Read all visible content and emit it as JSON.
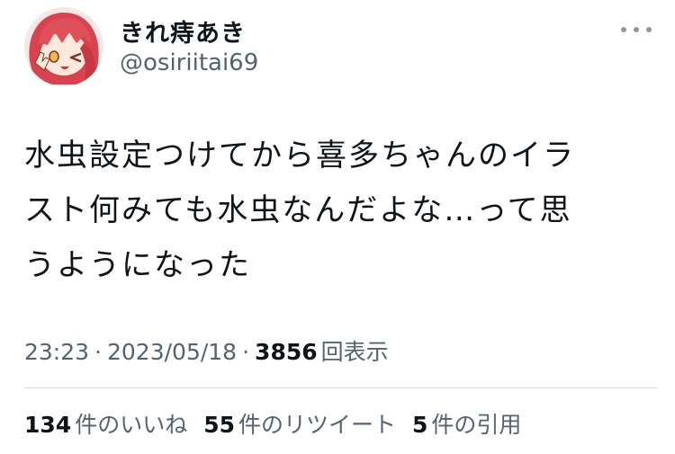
{
  "user": {
    "display_name": "きれ痔あき",
    "handle": "@osiriitai69"
  },
  "tweet": {
    "lines": [
      "水虫設定つけてから喜多ちゃんのイラ",
      "スト何みても水虫なんだよな…って思",
      "うようになった"
    ]
  },
  "meta": {
    "time": "23:23",
    "separator": "·",
    "date": "2023/05/18",
    "views": "3856",
    "views_label": "回表示"
  },
  "stats": {
    "likes": "134",
    "likes_label": "件のいいね",
    "retweets": "55",
    "retweets_label": "件のリツイート",
    "quotes": "5",
    "quotes_label": "件の引用"
  },
  "icons": {
    "avatar": "avatar-icon",
    "more": "more-icon"
  },
  "colors": {
    "text": "#0f1419",
    "secondary": "#536471",
    "divider": "#cfd9de",
    "avatar_hair": "#d9434f"
  }
}
